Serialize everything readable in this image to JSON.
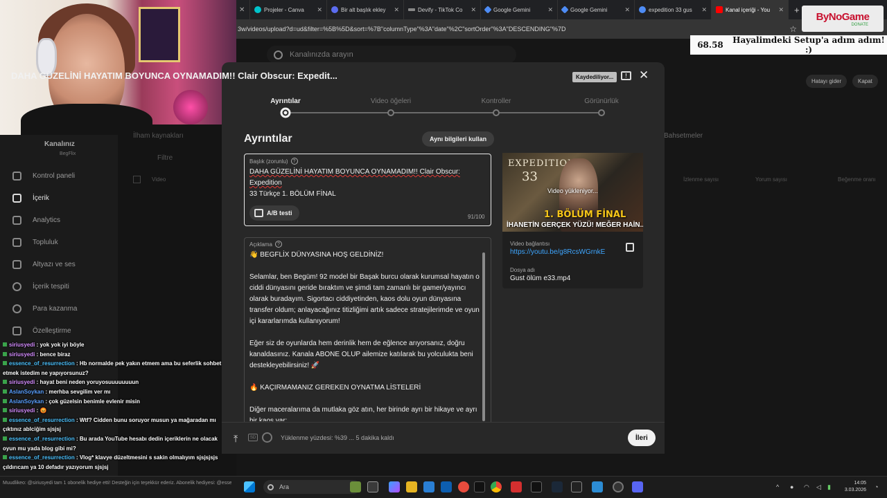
{
  "browser": {
    "tabs": [
      {
        "label": "Projeler - Canva",
        "color": "#00c4cc",
        "active": false
      },
      {
        "label": "Bir alt başlık ekley",
        "color": "#5b6cf0",
        "active": false
      },
      {
        "label": "Devify - TikTok Co",
        "color": "#888888",
        "active": false
      },
      {
        "label": "Google Gemini",
        "color": "#4e8cf5",
        "active": false
      },
      {
        "label": "Google Gemini",
        "color": "#4e8cf5",
        "active": false
      },
      {
        "label": "expedition 33 gus",
        "color": "#4e8cf5",
        "active": false
      },
      {
        "label": "Kanal içeriği - You",
        "color": "#ff0000",
        "active": true
      }
    ],
    "new_tab": "+",
    "url": "3w/videos/upload?d=ud&filter=%5B%5D&sort=%7B\"columnType\"%3A\"date\"%2C\"sortOrder\"%3A\"DESCENDING\"%7D"
  },
  "overlay": {
    "logo": "ByNoGame",
    "logo_sub": "DONATE",
    "goal_amount": "68.58",
    "goal_text": "Hayalimdeki Setup'a adım adım! :)"
  },
  "studio": {
    "search_placeholder": "Kanalınızda arayın",
    "fix_error": "Hatayı gider",
    "close": "Kapat",
    "channel_title": "Kanalınız",
    "channel_name": "BegFlix",
    "nav": [
      "Kontrol paneli",
      "İçerik",
      "Analytics",
      "Topluluk",
      "Altyazı ve ses",
      "İçerik tespiti",
      "Para kazanma",
      "Özelleştirme"
    ],
    "bg_columns": [
      "Video",
      "İzlenme sayısı",
      "Yorum sayısı",
      "Beğenme oranı"
    ],
    "bg_tab_left": "İlham kaynakları",
    "bg_tab_right": "Bahsetmeler",
    "bg_filter": "Filtre"
  },
  "modal": {
    "title": "DAHA GÜZELİNİ HAYATIM BOYUNCA OYNAMADIM!! Clair Obscur: Expedit...",
    "saving": "Kaydediliyor...",
    "close_glyph": "✕",
    "steps": [
      {
        "label": "Ayrıntılar",
        "active": true
      },
      {
        "label": "Video öğeleri",
        "active": false
      },
      {
        "label": "Kontroller",
        "active": false
      },
      {
        "label": "Görünürlük",
        "active": false
      }
    ],
    "section_title": "Ayrıntılar",
    "reuse_button": "Aynı bilgileri kullan",
    "title_field": {
      "label": "Başlık (zorunlu)",
      "value_a": "DAHA GÜZELİNİ HAYATIM BOYUNCA OYNAMADIM!! Clair Obscur: Expedition",
      "value_b": "33 Türkçe 1. BÖLÜM FİNAL",
      "count": "91/100"
    },
    "ab_test": "A/B testi",
    "description": {
      "label": "Açıklama",
      "paragraphs": [
        "👋 BEGFLİX DÜNYASINA HOŞ GELDİNİZ!",
        "Selamlar, ben Begüm! 92 model bir Başak burcu olarak kurumsal hayatın o ciddi dünyasını geride bıraktım ve şimdi tam zamanlı bir gamer/yayıncı olarak buradayım. Sigortacı ciddiyetinden, kaos dolu oyun dünyasına transfer oldum; anlayacağınız titizliğimi artık sadece stratejilerimde ve oyun içi kararlarımda kullanıyorum!",
        "Eğer siz de oyunlarda hem derinlik hem de eğlence arıyorsanız, doğru kanaldasınız. Kanala ABONE OLUP ailemize katılarak bu yolculukta beni destekleyebilirsiniz! 🚀",
        "🔥 KAÇIRMAMANIZ GEREKEN OYNATMA LİSTELERİ",
        "Diğer maceralarıma da mutlaka göz atın, her birinde ayrı bir hikaye ve ayrı bir kaos var:"
      ]
    },
    "thumbnail": {
      "word1": "EXPEDITION",
      "word2": "33",
      "uploading": "Video yükleniyor...",
      "episode": "1. BÖLÜM FİNAL",
      "tagline": "İHANETİN GERÇEK YÜZÜ! MEĞER HAİN..."
    },
    "video_link_label": "Video bağlantısı",
    "video_link": "https://youtu.be/g8RcsWGrnkE",
    "file_label": "Dosya adı",
    "file_name": "Gust ölüm e33.mp4",
    "footer_sd": "SD",
    "footer_status": "Yüklenme yüzdesi: %39 ... 5 dakika kaldı",
    "upload_percent": 39,
    "next_button": "İleri"
  },
  "chat": [
    {
      "user": "siriusyedi",
      "msg": "yok yok iyi böyle",
      "ucls": "u1"
    },
    {
      "user": "siriusyedi",
      "msg": "bence biraz",
      "ucls": "u1"
    },
    {
      "user": "essence_of_resurrection",
      "msg": "Hb normalde pek yakın etmem ama bu seferlik sohbet etmek istedim ne yapıyorsunuz?",
      "ucls": "u2"
    },
    {
      "user": "siriusyedi",
      "msg": "hayat beni neden yoruyosuuuuuuuun",
      "ucls": "u1"
    },
    {
      "user": "AslanSoykan",
      "msg": "merhba sevgilim ver mı",
      "ucls": "u3"
    },
    {
      "user": "AslanSoykan",
      "msg": "çok güzelsin benimle evlenir misin",
      "ucls": "u3"
    },
    {
      "user": "siriusyedi",
      "msg": "😡",
      "ucls": "u1"
    },
    {
      "user": "essence_of_resurrection",
      "msg": "Wtf? Cidden bunu soruyor musun ya mağaradan mı çıktınız ablciğim sjsjsj",
      "ucls": "u2"
    },
    {
      "user": "essence_of_resurrection",
      "msg": "Bu arada YouTube hesabı dedin içeriklerin ne olacak oyun mu yada blog gibi mi?",
      "ucls": "u2"
    },
    {
      "user": "essence_of_resurrection",
      "msg": "Vlog* klavye düzeltmesini s sakin olmalıyım sjsjsjsjs çıldırıcam ya 10 defadır yazıyorum sjsjsj",
      "ucls": "u2"
    }
  ],
  "ticker": "Muudlikeo: @siriusyedi tam 1 obonelik hediye etti! Desteğin için teşekkür ederiz. Abonelik hediyesi: @essence_of_resurrection",
  "taskbar": {
    "search": "Ara",
    "time": "14:05",
    "date": "3.03.2026"
  }
}
